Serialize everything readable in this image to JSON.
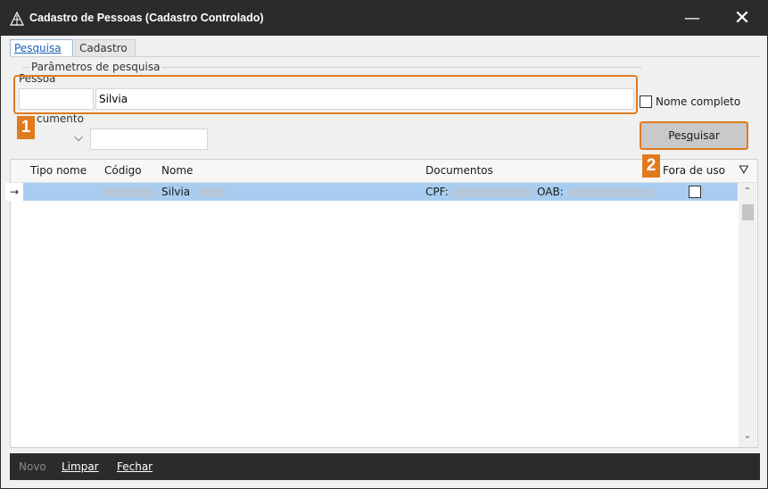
{
  "window": {
    "title": "Cadastro de Pessoas (Cadastro Controlado)"
  },
  "tabs": [
    {
      "label": "Pesquisa"
    },
    {
      "label": "Cadastro"
    }
  ],
  "search": {
    "group_label": "Parâmetros de pesquisa",
    "pessoa_label": "Pessoa",
    "pessoa_value": "Silvia",
    "documento_label": "cumento",
    "nome_completo_label": "Nome completo",
    "pesquisar_label_pre": "Pes",
    "pesquisar_label_accel": "q",
    "pesquisar_label_post": "uisar"
  },
  "badges": {
    "one": "1",
    "two": "2"
  },
  "grid": {
    "columns": {
      "tipo": "Tipo nome",
      "codigo": "Código",
      "nome": "Nome",
      "documentos": "Documentos",
      "fora": "Fora de uso"
    },
    "rows": [
      {
        "indicator": "→",
        "nome": "Silvia",
        "cpf_label": "CPF:",
        "oab_label": "OAB:"
      }
    ]
  },
  "bottom": {
    "novo": "Novo",
    "limpar": "Limpar",
    "fechar": "Fechar"
  },
  "colors": {
    "accent": "#e07a1f",
    "titlebar": "#2b2b2b",
    "selection": "#a9cdf0"
  }
}
